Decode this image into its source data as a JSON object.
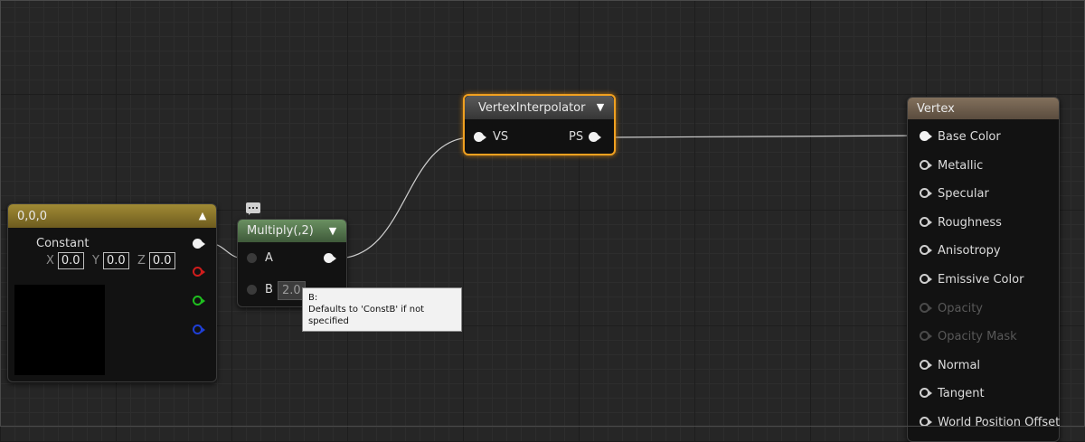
{
  "constant_node": {
    "title": "0,0,0",
    "label": "Constant",
    "x_label": "X",
    "x_value": "0.0",
    "y_label": "Y",
    "y_value": "0.0",
    "z_label": "Z",
    "z_value": "0.0",
    "header_color": "#8a7526",
    "pin_colors": [
      "#f2f2f2",
      "#d01c1c",
      "#1fbf1f",
      "#1f3fd6"
    ]
  },
  "multiply_node": {
    "title": "Multiply(,2)",
    "input_a": "A",
    "input_b": "B",
    "b_value": "2.0",
    "header_color": "#4d6e47",
    "comment_icon": "speech-bubble-icon"
  },
  "tooltip": {
    "line1": "B:",
    "line2": "Defaults to 'ConstB' if not specified"
  },
  "interpolator_node": {
    "title": "VertexInterpolator",
    "input": "VS",
    "output": "PS",
    "header_color": "#444444",
    "highlight_color": "#f0a020"
  },
  "vertex_node": {
    "title": "Vertex",
    "header_color": "#6b5b4b",
    "inputs": [
      {
        "label": "Base Color",
        "state": "connected"
      },
      {
        "label": "Metallic",
        "state": "active"
      },
      {
        "label": "Specular",
        "state": "active"
      },
      {
        "label": "Roughness",
        "state": "active"
      },
      {
        "label": "Anisotropy",
        "state": "active"
      },
      {
        "label": "Emissive Color",
        "state": "active"
      },
      {
        "label": "Opacity",
        "state": "disabled"
      },
      {
        "label": "Opacity Mask",
        "state": "disabled"
      },
      {
        "label": "Normal",
        "state": "active"
      },
      {
        "label": "Tangent",
        "state": "active"
      },
      {
        "label": "World Position Offset",
        "state": "active"
      }
    ]
  }
}
